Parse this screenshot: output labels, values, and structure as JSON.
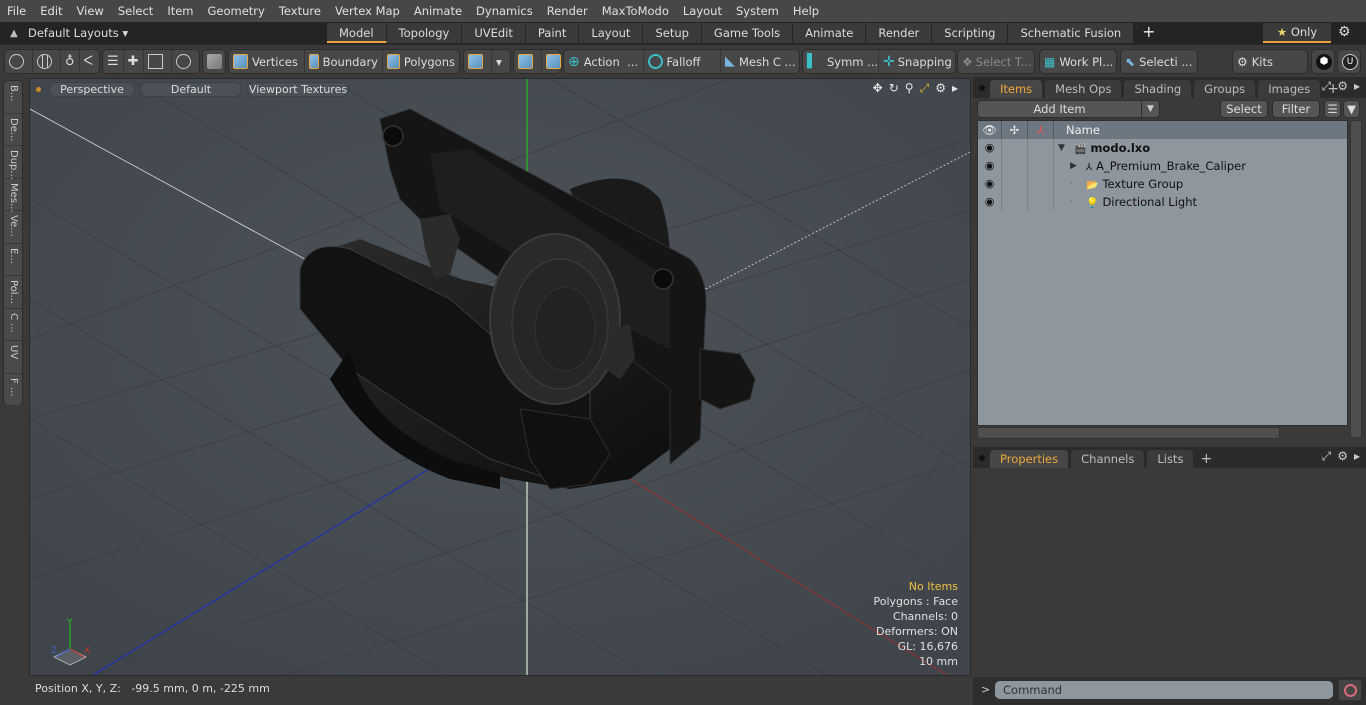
{
  "menubar": [
    "File",
    "Edit",
    "View",
    "Select",
    "Item",
    "Geometry",
    "Texture",
    "Vertex Map",
    "Animate",
    "Dynamics",
    "Render",
    "MaxToModo",
    "Layout",
    "System",
    "Help"
  ],
  "layoutbar": {
    "layouts_label": "Default Layouts",
    "tabs": [
      "Model",
      "Topology",
      "UVEdit",
      "Paint",
      "Layout",
      "Setup",
      "Game Tools",
      "Animate",
      "Render",
      "Scripting",
      "Schematic Fusion"
    ],
    "active_tab": "Model",
    "plus": "+",
    "only_label": "Only"
  },
  "toolbar": {
    "vertices": "Vertices",
    "boundary": "Boundary",
    "polygons": "Polygons",
    "action": "Action",
    "falloff": "Falloff",
    "mesh_c": "Mesh C ...",
    "symm": "Symm ...",
    "snapping": "Snapping",
    "select_t": "Select T...",
    "work_pl": "Work Pl...",
    "selecti": "Selecti ...",
    "kits": "Kits",
    "ellipsis": "..."
  },
  "left_tabs": [
    "B...",
    "De...",
    "Dup...",
    "Mes...",
    "Ve...",
    "E...",
    "Pol...",
    "C ...",
    "UV",
    "F ..."
  ],
  "viewport": {
    "view_mode": "Perspective",
    "shading": "Default",
    "textures": "Viewport Textures",
    "info": {
      "selection": "No Items",
      "polygons": "Polygons : Face",
      "channels": "Channels: 0",
      "deformers": "Deformers: ON",
      "gl": "GL: 16,676",
      "scale": "10 mm"
    },
    "axes": {
      "x": "X",
      "y": "Y",
      "z": "Z"
    }
  },
  "status": {
    "position_label": "Position X, Y, Z:",
    "position_value": "-99.5 mm, 0 m, -225 mm"
  },
  "items_panel": {
    "tabs": [
      "Items",
      "Mesh Ops",
      "Shading",
      "Groups",
      "Images"
    ],
    "active_tab": "Items",
    "add_item": "Add Item",
    "select": "Select",
    "filter": "Filter",
    "column_name": "Name",
    "tree": [
      {
        "name": "modo.lxo",
        "level": 0,
        "bold": true,
        "icon": "scene-icon",
        "expanded": true
      },
      {
        "name": "A_Premium_Brake_Caliper",
        "level": 1,
        "icon": "mesh-locator-icon",
        "expandable": true
      },
      {
        "name": "Texture Group",
        "level": 1,
        "icon": "folder-icon"
      },
      {
        "name": "Directional Light",
        "level": 1,
        "icon": "light-icon"
      }
    ]
  },
  "properties_panel": {
    "tabs": [
      "Properties",
      "Channels",
      "Lists"
    ],
    "active_tab": "Properties"
  },
  "command": {
    "prompt": ">",
    "placeholder": "Command"
  },
  "colors": {
    "accent": "#e8a33d",
    "info_highlight": "#f0c040",
    "axis_x": "#c0392b",
    "axis_y": "#22c022",
    "axis_z": "#2233aa"
  }
}
